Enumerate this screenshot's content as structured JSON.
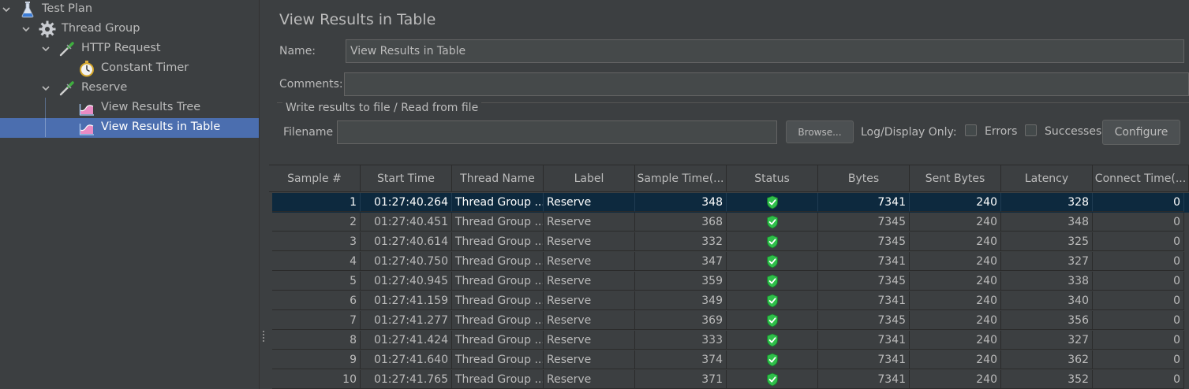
{
  "tree": {
    "items": [
      {
        "label": "Test Plan",
        "icon": "flask-icon",
        "expanded": true
      },
      {
        "label": "Thread Group",
        "icon": "gear-icon",
        "expanded": true
      },
      {
        "label": "HTTP Request",
        "icon": "pipette-icon",
        "expanded": true
      },
      {
        "label": "Constant Timer",
        "icon": "stopwatch-icon"
      },
      {
        "label": "Reserve",
        "icon": "pipette-icon",
        "expanded": true
      },
      {
        "label": "View Results Tree",
        "icon": "chart-icon"
      },
      {
        "label": "View Results in Table",
        "icon": "chart-icon",
        "selected": true
      }
    ]
  },
  "panel": {
    "title": "View Results in Table",
    "name_label": "Name:",
    "name_value": "View Results in Table",
    "comments_label": "Comments:",
    "comments_value": "",
    "file_section_label": "Write results to file / Read from file",
    "filename_label": "Filename",
    "filename_value": "",
    "browse_label": "Browse...",
    "log_display_label": "Log/Display Only:",
    "errors_label": "Errors",
    "successes_label": "Successes",
    "configure_label": "Configure"
  },
  "table": {
    "columns": [
      "Sample #",
      "Start Time",
      "Thread Name",
      "Label",
      "Sample Time(...",
      "Status",
      "Bytes",
      "Sent Bytes",
      "Latency",
      "Connect Time(..."
    ],
    "rows": [
      {
        "num": "1",
        "start": "01:27:40.264",
        "thread": "Thread Group ...",
        "label": "Reserve",
        "sample_time": "348",
        "status": "success-shield-icon",
        "bytes": "7341",
        "sent": "240",
        "latency": "328",
        "connect": "0"
      },
      {
        "num": "2",
        "start": "01:27:40.451",
        "thread": "Thread Group ...",
        "label": "Reserve",
        "sample_time": "368",
        "status": "success-shield-icon",
        "bytes": "7345",
        "sent": "240",
        "latency": "348",
        "connect": "0"
      },
      {
        "num": "3",
        "start": "01:27:40.614",
        "thread": "Thread Group ...",
        "label": "Reserve",
        "sample_time": "332",
        "status": "success-shield-icon",
        "bytes": "7345",
        "sent": "240",
        "latency": "325",
        "connect": "0"
      },
      {
        "num": "4",
        "start": "01:27:40.750",
        "thread": "Thread Group ...",
        "label": "Reserve",
        "sample_time": "347",
        "status": "success-shield-icon",
        "bytes": "7341",
        "sent": "240",
        "latency": "327",
        "connect": "0"
      },
      {
        "num": "5",
        "start": "01:27:40.945",
        "thread": "Thread Group ...",
        "label": "Reserve",
        "sample_time": "359",
        "status": "success-shield-icon",
        "bytes": "7345",
        "sent": "240",
        "latency": "338",
        "connect": "0"
      },
      {
        "num": "6",
        "start": "01:27:41.159",
        "thread": "Thread Group ...",
        "label": "Reserve",
        "sample_time": "349",
        "status": "success-shield-icon",
        "bytes": "7341",
        "sent": "240",
        "latency": "340",
        "connect": "0"
      },
      {
        "num": "7",
        "start": "01:27:41.277",
        "thread": "Thread Group ...",
        "label": "Reserve",
        "sample_time": "369",
        "status": "success-shield-icon",
        "bytes": "7345",
        "sent": "240",
        "latency": "356",
        "connect": "0"
      },
      {
        "num": "8",
        "start": "01:27:41.424",
        "thread": "Thread Group ...",
        "label": "Reserve",
        "sample_time": "333",
        "status": "success-shield-icon",
        "bytes": "7341",
        "sent": "240",
        "latency": "327",
        "connect": "0"
      },
      {
        "num": "9",
        "start": "01:27:41.640",
        "thread": "Thread Group ...",
        "label": "Reserve",
        "sample_time": "374",
        "status": "success-shield-icon",
        "bytes": "7341",
        "sent": "240",
        "latency": "362",
        "connect": "0"
      },
      {
        "num": "10",
        "start": "01:27:41.765",
        "thread": "Thread Group ...",
        "label": "Reserve",
        "sample_time": "371",
        "status": "success-shield-icon",
        "bytes": "7341",
        "sent": "240",
        "latency": "352",
        "connect": "0"
      }
    ]
  },
  "colors": {
    "background": "#3c3f41",
    "tree_selected": "#4b6eaf",
    "row_selected": "#0d293e",
    "text": "#bbbbbb",
    "success": "#2fbf4a"
  }
}
